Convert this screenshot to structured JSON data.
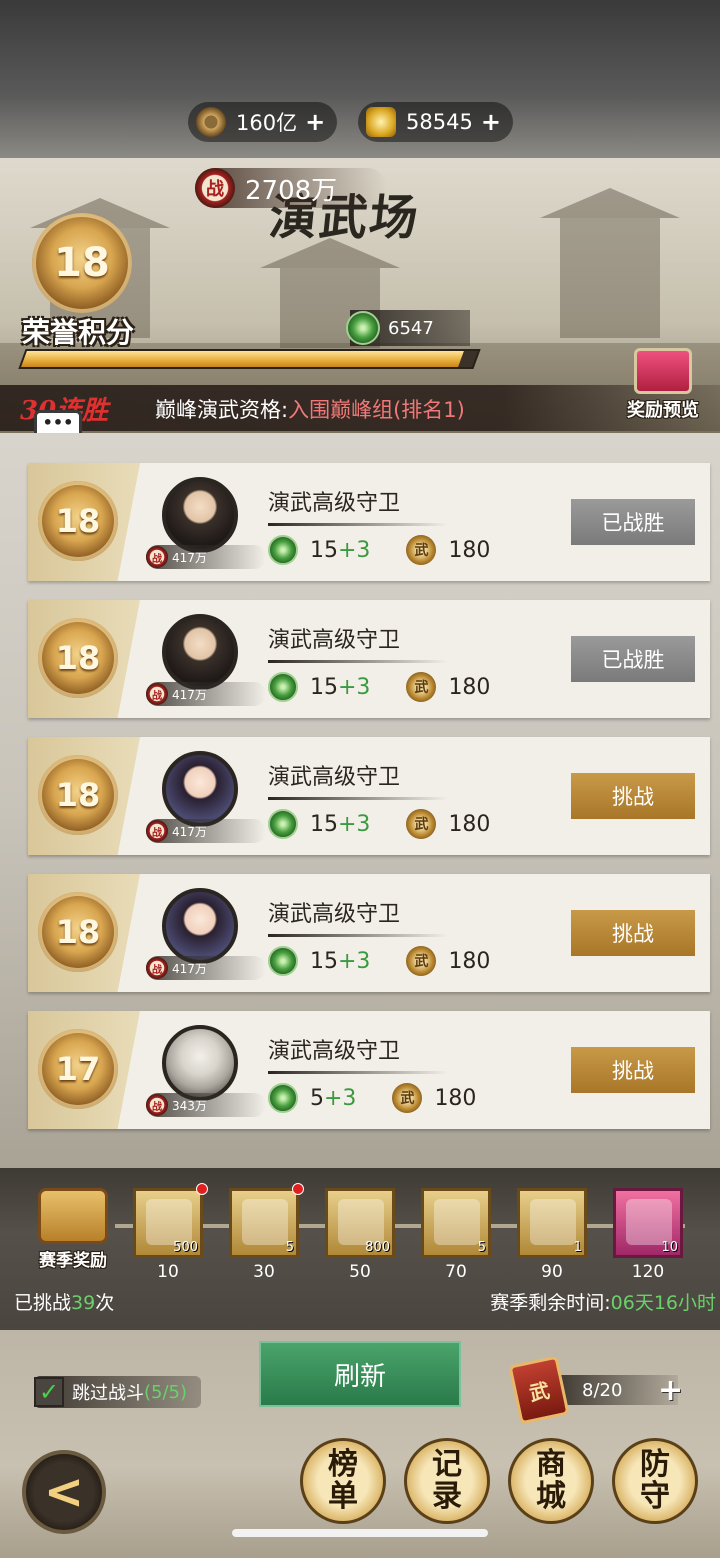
{
  "currency": {
    "coins": "160亿",
    "gold": "58545",
    "plus": "+"
  },
  "banner": {
    "power_icon": "战",
    "power": "2708万",
    "title": "演武场",
    "rank": "18",
    "honor_label": "荣誉积分",
    "honor_points": "6547",
    "honor_progress": 0.97,
    "streak": "30连胜",
    "qualification_label": "巅峰演武资格:",
    "qualification_value": "入围巅峰组(排名1)",
    "reward_preview": "奖励预览",
    "chat_icon": "•••",
    "chat": "聊天"
  },
  "opponents": [
    {
      "rank": "18",
      "power": "417万",
      "name": "演武高级守卫",
      "points": "15",
      "bonus": "+3",
      "coins": "180",
      "action": "已战胜",
      "state": "won"
    },
    {
      "rank": "18",
      "power": "417万",
      "name": "演武高级守卫",
      "points": "15",
      "bonus": "+3",
      "coins": "180",
      "action": "已战胜",
      "state": "won"
    },
    {
      "rank": "18",
      "power": "417万",
      "name": "演武高级守卫",
      "points": "15",
      "bonus": "+3",
      "coins": "180",
      "action": "挑战",
      "state": "challenge"
    },
    {
      "rank": "18",
      "power": "417万",
      "name": "演武高级守卫",
      "points": "15",
      "bonus": "+3",
      "coins": "180",
      "action": "挑战",
      "state": "challenge"
    },
    {
      "rank": "17",
      "power": "343万",
      "name": "演武高级守卫",
      "points": "5",
      "bonus": "+3",
      "coins": "180",
      "action": "挑战",
      "state": "challenge"
    }
  ],
  "icons": {
    "power_mini": "战",
    "wu_coin": "武"
  },
  "season": {
    "chest_label": "赛季奖励",
    "rewards": [
      {
        "qty": "500",
        "threshold": "10",
        "dot": true,
        "color": "gold"
      },
      {
        "qty": "5",
        "threshold": "30",
        "dot": true,
        "color": "gold"
      },
      {
        "qty": "800",
        "threshold": "50",
        "dot": false,
        "color": "gold"
      },
      {
        "qty": "5",
        "threshold": "70",
        "dot": false,
        "color": "gold"
      },
      {
        "qty": "1",
        "threshold": "90",
        "dot": false,
        "color": "gold"
      },
      {
        "qty": "10",
        "threshold": "120",
        "dot": false,
        "color": "purple"
      }
    ],
    "challenged_prefix": "已挑战",
    "challenged_count": "39",
    "challenged_suffix": "次",
    "remaining_label": "赛季剩余时间:",
    "remaining_value": "06天16小时"
  },
  "bottom": {
    "skip_label": "跳过战斗",
    "skip_count": "(5/5)",
    "refresh": "刷新",
    "ticket_icon": "武",
    "tickets": "8/20",
    "plus": "+",
    "back": "<",
    "nav": [
      {
        "line1": "榜",
        "line2": "单"
      },
      {
        "line1": "记",
        "line2": "录"
      },
      {
        "line1": "商",
        "line2": "城"
      },
      {
        "line1": "防",
        "line2": "守"
      }
    ]
  },
  "colors": {
    "accent_green": "#6ad06a",
    "challenge_button": "#b8862e",
    "won_button": "#8a8a8a",
    "streak_red": "#e03030"
  }
}
